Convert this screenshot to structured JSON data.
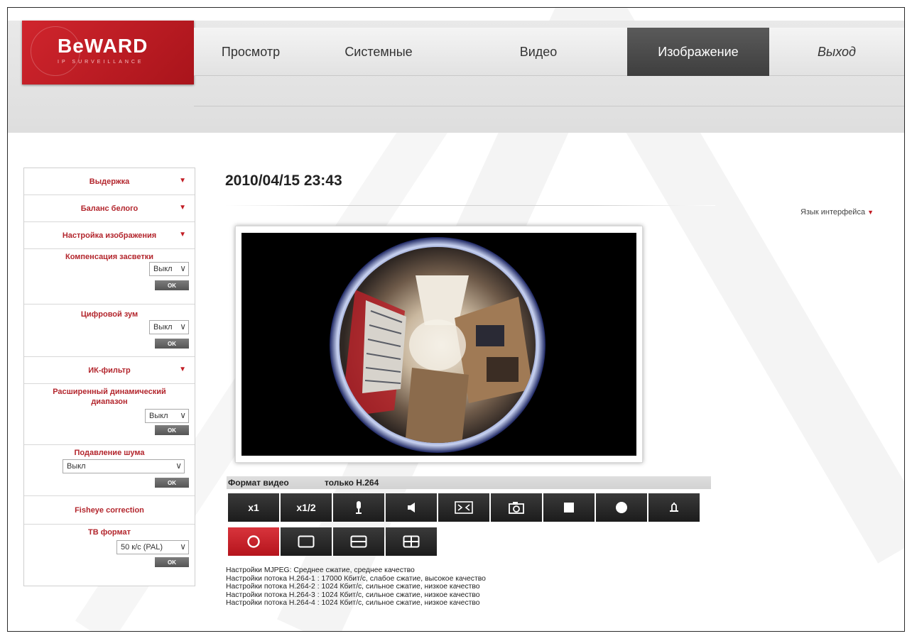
{
  "logo": {
    "text": "BeWARD",
    "subtitle": "IP SURVEILLANCE"
  },
  "nav": {
    "items": [
      {
        "label": "Просмотр",
        "active": false
      },
      {
        "label": "Системные",
        "active": false
      },
      {
        "label": "Видео",
        "active": false
      },
      {
        "label": "Изображение",
        "active": true
      },
      {
        "label": "Выход",
        "active": false
      }
    ]
  },
  "sidebar": {
    "exposure": "Выдержка",
    "white_balance": "Баланс белого",
    "image_settings": "Настройка изображения",
    "backlight": {
      "title": "Компенсация засветки",
      "value": "Выкл",
      "ok": "OK"
    },
    "digital_zoom": {
      "title": "Цифровой зум",
      "value": "Выкл",
      "ok": "OK"
    },
    "ir_filter": "ИК-фильтр",
    "wdr": {
      "title": "Расширенный динамический диапазон",
      "value": "Выкл",
      "ok": "OK"
    },
    "noise": {
      "title": "Подавление шума",
      "value": "Выкл",
      "ok": "OK"
    },
    "fisheye": "Fisheye correction",
    "tv_format": {
      "title": "ТВ формат",
      "value": "50 к/с (PAL)",
      "ok": "OK"
    }
  },
  "main": {
    "datetime": "2010/04/15 23:43",
    "language": "Язык интерфейса",
    "video_format_label": "Формат видео",
    "video_format_value": "только H.264",
    "controls_row1": [
      {
        "label": "x1",
        "icon": null
      },
      {
        "label": "x1/2",
        "icon": null
      },
      {
        "label": "",
        "icon": "microphone-icon"
      },
      {
        "label": "",
        "icon": "speaker-icon"
      },
      {
        "label": "",
        "icon": "fit-screen-icon"
      },
      {
        "label": "",
        "icon": "camera-icon"
      },
      {
        "label": "",
        "icon": "stop-icon"
      },
      {
        "label": "",
        "icon": "record-icon"
      },
      {
        "label": "",
        "icon": "alarm-bell-icon"
      }
    ],
    "controls_row2": [
      {
        "icon": "fisheye-circle-icon",
        "active": true
      },
      {
        "icon": "single-view-icon",
        "active": false
      },
      {
        "icon": "dual-view-icon",
        "active": false
      },
      {
        "icon": "quad-view-icon",
        "active": false
      }
    ],
    "stream_settings": [
      "Настройки MJPEG: Среднее сжатие, среднее качество",
      "Настройки потока H.264-1 : 17000 Кбит/с, слабое сжатие, высокое качество",
      "Настройки потока H.264-2 : 1024 Кбит/с, сильное сжатие, низкое качество",
      "Настройки потока H.264-3 : 1024 Кбит/с, сильное сжатие, низкое качество",
      "Настройки потока H.264-4 : 1024 Кбит/с, сильное сжатие, низкое качество"
    ]
  },
  "colors": {
    "brand_red": "#c21d25",
    "nav_active": "#4a4a4a",
    "button_dark": "#2a2a2a"
  }
}
